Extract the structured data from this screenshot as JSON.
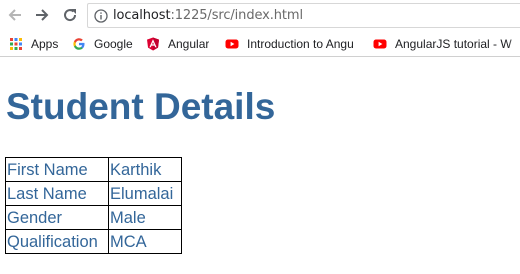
{
  "browser": {
    "url_host": "localhost",
    "url_path": ":1225/src/index.html",
    "bookmarks": [
      {
        "label": "Apps",
        "icon": "apps-grid-icon"
      },
      {
        "label": "Google",
        "icon": "google-icon"
      },
      {
        "label": "Angular",
        "icon": "angular-icon"
      },
      {
        "label": "Introduction to Angu",
        "icon": "youtube-icon"
      },
      {
        "label": "AngularJS tutorial - W",
        "icon": "youtube-icon"
      }
    ]
  },
  "page": {
    "title": "Student Details",
    "title_color": "#336699",
    "rows": [
      {
        "key": "First Name",
        "value": "Karthik"
      },
      {
        "key": "Last Name",
        "value": "Elumalai"
      },
      {
        "key": "Gender",
        "value": "Male"
      },
      {
        "key": "Qualification",
        "value": "MCA"
      }
    ]
  }
}
